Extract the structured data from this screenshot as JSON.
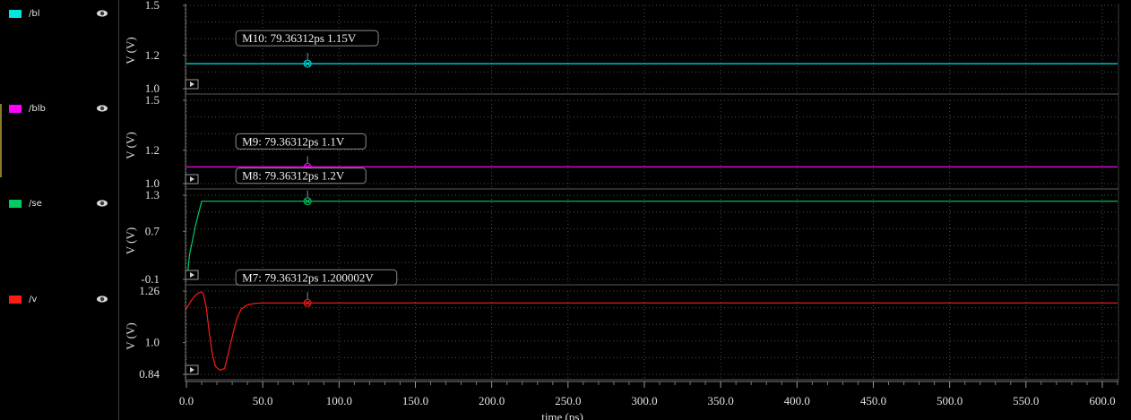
{
  "legend": [
    {
      "label": "/bl",
      "color": "#00e5e5"
    },
    {
      "label": "/blb",
      "color": "#ff00ff"
    },
    {
      "label": "/se",
      "color": "#00cc66"
    },
    {
      "label": "/v",
      "color": "#ff1a1a"
    }
  ],
  "chart_data": {
    "type": "line",
    "xlabel": "time (ps)",
    "xlim": [
      0,
      610
    ],
    "x_ticks": [
      "0.0",
      "50.0",
      "100.0",
      "150.0",
      "200.0",
      "250.0",
      "300.0",
      "350.0",
      "400.0",
      "450.0",
      "500.0",
      "550.0",
      "600.0"
    ],
    "grid": true,
    "subplots": [
      {
        "series": "/bl",
        "color": "#00e5e5",
        "ylabel": "V (V)",
        "ylim": [
          1.0,
          1.5
        ],
        "y_ticks": [
          "1.5",
          "1.2",
          "1.0"
        ],
        "y_tick_values": [
          1.5,
          1.2,
          1.0
        ],
        "x": [
          0,
          610
        ],
        "y": [
          1.15,
          1.15
        ],
        "marker": {
          "label": "M10: 79.36312ps 1.15V",
          "x": 79.36312,
          "y": 1.15
        }
      },
      {
        "series": "/blb",
        "color": "#ff00ff",
        "ylabel": "V (V)",
        "ylim": [
          1.0,
          1.5
        ],
        "y_ticks": [
          "1.5",
          "1.2",
          "1.0"
        ],
        "y_tick_values": [
          1.5,
          1.2,
          1.0
        ],
        "x": [
          0,
          610
        ],
        "y": [
          1.1,
          1.1
        ],
        "marker": {
          "label": "M9: 79.36312ps 1.1V",
          "x": 79.36312,
          "y": 1.1
        }
      },
      {
        "series": "/se",
        "color": "#00cc66",
        "ylabel": "V (V)",
        "ylim": [
          -0.1,
          1.3
        ],
        "y_ticks": [
          "1.3",
          "0.7",
          "-0.1"
        ],
        "y_tick_values": [
          1.3,
          0.7,
          -0.1
        ],
        "x": [
          0,
          1,
          2,
          4,
          6,
          8,
          10,
          610
        ],
        "y": [
          -0.05,
          0.05,
          0.3,
          0.55,
          0.8,
          1.0,
          1.2,
          1.2
        ],
        "marker": {
          "label": "M8: 79.36312ps 1.2V",
          "x": 79.36312,
          "y": 1.2
        }
      },
      {
        "series": "/v",
        "color": "#ff1a1a",
        "ylabel": "V (V)",
        "ylim": [
          0.84,
          1.26
        ],
        "y_ticks": [
          "1.26",
          "1.0",
          "0.84"
        ],
        "y_tick_values": [
          1.26,
          1.0,
          0.84
        ],
        "x": [
          0,
          3,
          6,
          9,
          11,
          13,
          15,
          17,
          19,
          22,
          25,
          27,
          30,
          33,
          36,
          40,
          45,
          50,
          60,
          610
        ],
        "y": [
          1.17,
          1.21,
          1.24,
          1.255,
          1.25,
          1.18,
          1.05,
          0.94,
          0.88,
          0.86,
          0.87,
          0.93,
          1.03,
          1.12,
          1.17,
          1.19,
          1.198,
          1.2,
          1.2,
          1.2
        ],
        "marker": {
          "label": "M7: 79.36312ps 1.200002V",
          "x": 79.36312,
          "y": 1.200002
        }
      }
    ]
  }
}
